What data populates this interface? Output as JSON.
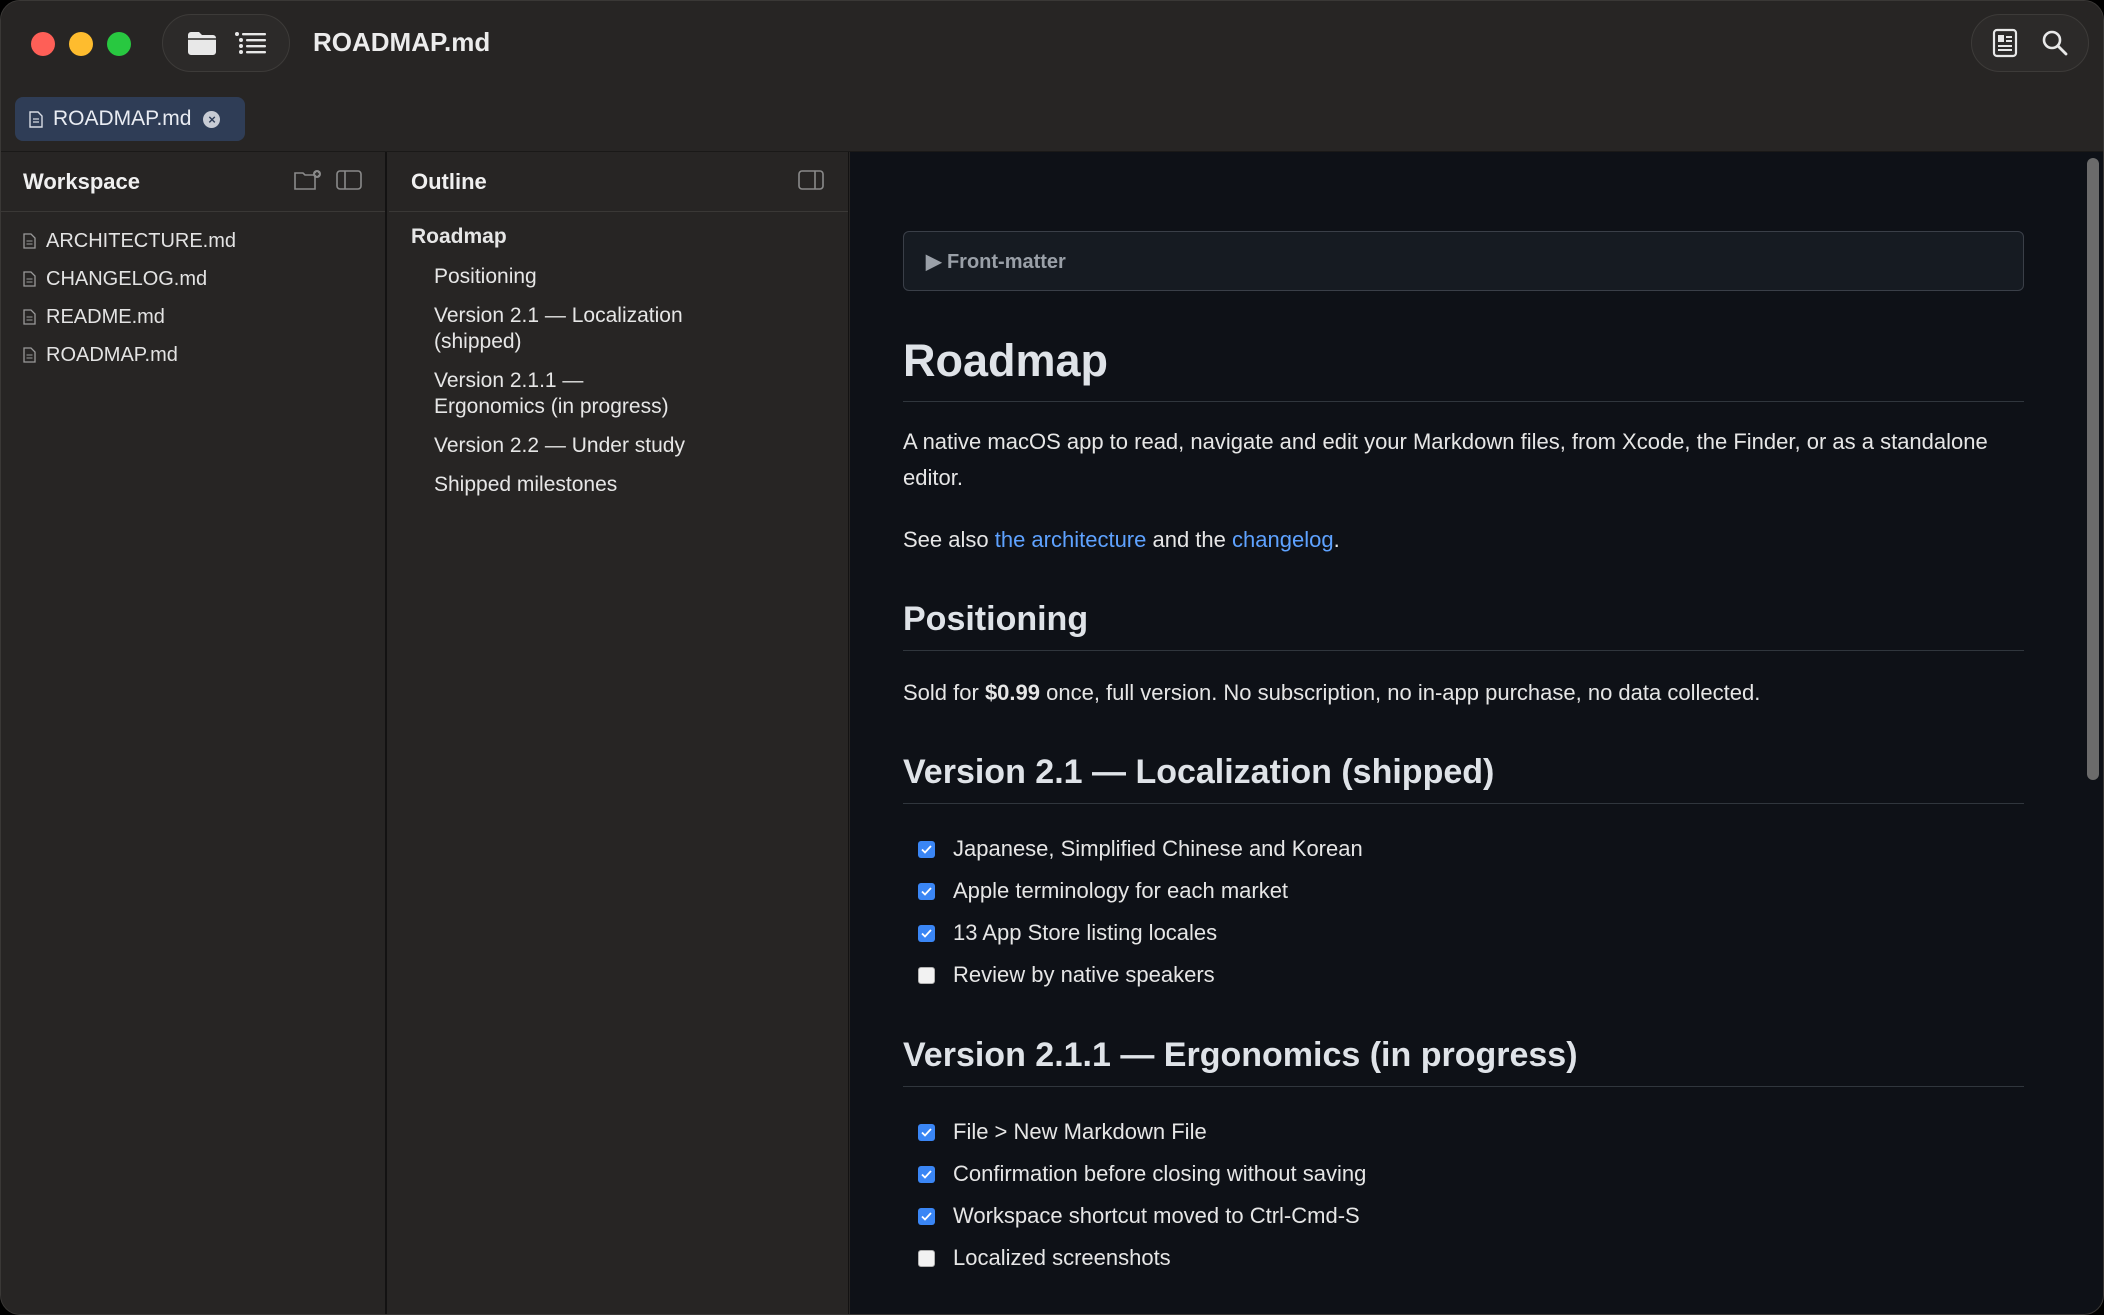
{
  "window": {
    "title": "ROADMAP.md"
  },
  "tabs": [
    {
      "label": "ROADMAP.md"
    }
  ],
  "workspace": {
    "title": "Workspace",
    "files": [
      {
        "label": "ARCHITECTURE.md"
      },
      {
        "label": "CHANGELOG.md"
      },
      {
        "label": "README.md"
      },
      {
        "label": "ROADMAP.md"
      }
    ]
  },
  "outline": {
    "title": "Outline",
    "items": [
      {
        "label": "Roadmap"
      },
      {
        "label": "Positioning"
      },
      {
        "label": "Version 2.1 — Localization (shipped)"
      },
      {
        "label": "Version 2.1.1 — Ergonomics (in progress)"
      },
      {
        "label": "Version 2.2 — Under study"
      },
      {
        "label": "Shipped milestones"
      }
    ]
  },
  "doc": {
    "front_matter": "▶ Front-matter",
    "h1": "Roadmap",
    "intro": "A native macOS app to read, navigate and edit your Markdown files, from Xcode, the Finder, or as a standalone editor.",
    "see_also": {
      "prefix": "See also ",
      "link1": "the architecture",
      "middle": " and the ",
      "link2": "changelog",
      "suffix": "."
    },
    "positioning": {
      "heading": "Positioning",
      "prefix": "Sold for ",
      "price": "$0.99",
      "suffix": " once, full version. No subscription, no in-app purchase, no data collected."
    },
    "v21": {
      "heading": "Version 2.1 — Localization (shipped)",
      "tasks": [
        {
          "label": "Japanese, Simplified Chinese and Korean",
          "checked": true
        },
        {
          "label": "Apple terminology for each market",
          "checked": true
        },
        {
          "label": "13 App Store listing locales",
          "checked": true
        },
        {
          "label": "Review by native speakers",
          "checked": false
        }
      ]
    },
    "v211": {
      "heading": "Version 2.1.1 — Ergonomics (in progress)",
      "tasks": [
        {
          "label": "File > New Markdown File",
          "checked": true
        },
        {
          "label": "Confirmation before closing without saving",
          "checked": true
        },
        {
          "label": "Workspace shortcut moved to Ctrl-Cmd-S",
          "checked": true
        },
        {
          "label": "Localized screenshots",
          "checked": false
        }
      ]
    }
  },
  "colors": {
    "accent": "#3a86f5",
    "link": "#5ea2ff",
    "content_bg": "#0e1117",
    "sidebar_bg": "#272524"
  }
}
